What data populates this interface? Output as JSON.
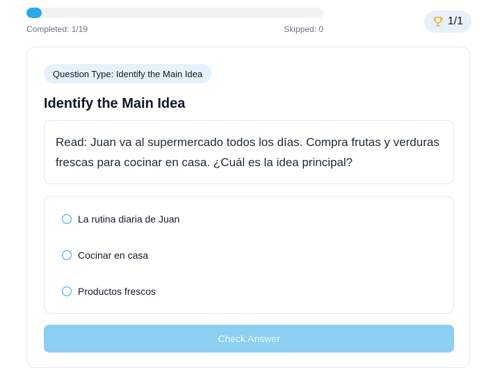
{
  "progress": {
    "fraction": 0.0526,
    "completed_label": "Completed: 1/19",
    "skipped_label": "Skipped: 0",
    "fill_color": "#2aa8e8"
  },
  "score": {
    "icon": "trophy-icon",
    "value": "1/1",
    "icon_color": "#e6b325"
  },
  "question": {
    "type_label": "Question Type: Identify the Main Idea",
    "title": "Identify the Main Idea",
    "prompt": "Read: Juan va al supermercado todos los días. Compra frutas y verduras frescas para cocinar en casa. ¿Cuál es la idea principal?",
    "options": [
      {
        "label": "La rutina diaria de Juan"
      },
      {
        "label": "Cocinar en casa"
      },
      {
        "label": "Productos frescos"
      }
    ]
  },
  "actions": {
    "check_label": "Check Answer",
    "check_color": "#8ccff0"
  }
}
